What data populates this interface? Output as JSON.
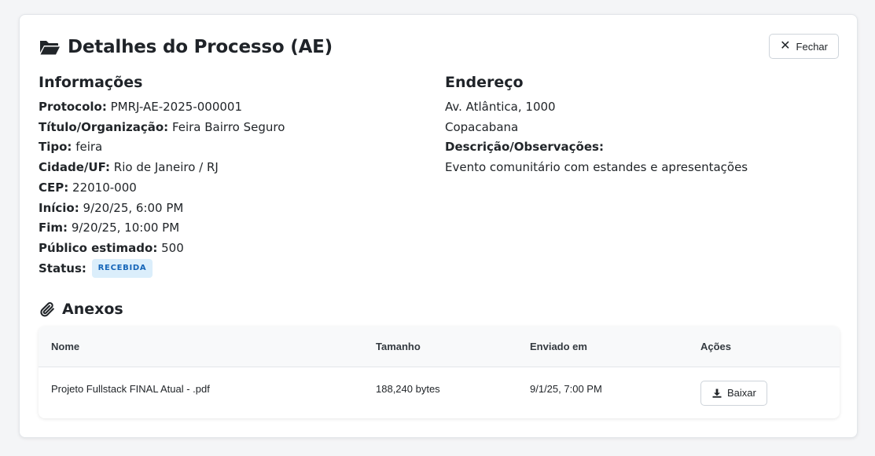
{
  "header": {
    "title": "Detalhes do Processo (AE)",
    "close_label": "Fechar"
  },
  "info": {
    "section_title": "Informações",
    "fields": [
      {
        "label": "Protocolo:",
        "value": "PMRJ-AE-2025-000001"
      },
      {
        "label": "Título/Organização:",
        "value": "Feira Bairro Seguro"
      },
      {
        "label": "Tipo:",
        "value": "feira"
      },
      {
        "label": "Cidade/UF:",
        "value": "Rio de Janeiro / RJ"
      },
      {
        "label": "CEP:",
        "value": "22010-000"
      },
      {
        "label": "Início:",
        "value": "9/20/25, 6:00 PM"
      },
      {
        "label": "Fim:",
        "value": "9/20/25, 10:00 PM"
      },
      {
        "label": "Público estimado:",
        "value": "500"
      }
    ],
    "status_label": "Status:",
    "status_value": "RECEBIDA"
  },
  "address": {
    "section_title": "Endereço",
    "street": "Av. Atlântica, 1000",
    "district": "Copacabana",
    "notes_label": "Descrição/Observações:",
    "notes_value": "Evento comunitário com estandes e apresentações"
  },
  "attachments": {
    "section_title": "Anexos",
    "columns": [
      "Nome",
      "Tamanho",
      "Enviado em",
      "Ações"
    ],
    "rows": [
      {
        "name": "Projeto Fullstack FINAL Atual - .pdf",
        "size": "188,240 bytes",
        "sent": "9/1/25, 7:00 PM",
        "action_label": "Baixar"
      }
    ]
  },
  "icons": {
    "header": "folder-open-icon",
    "close": "close-icon",
    "attachments": "paperclip-icon",
    "download": "download-icon"
  },
  "colors": {
    "badge_bg": "#dbeefb",
    "badge_text": "#1565b8",
    "page_bg": "#f4f5f7"
  }
}
